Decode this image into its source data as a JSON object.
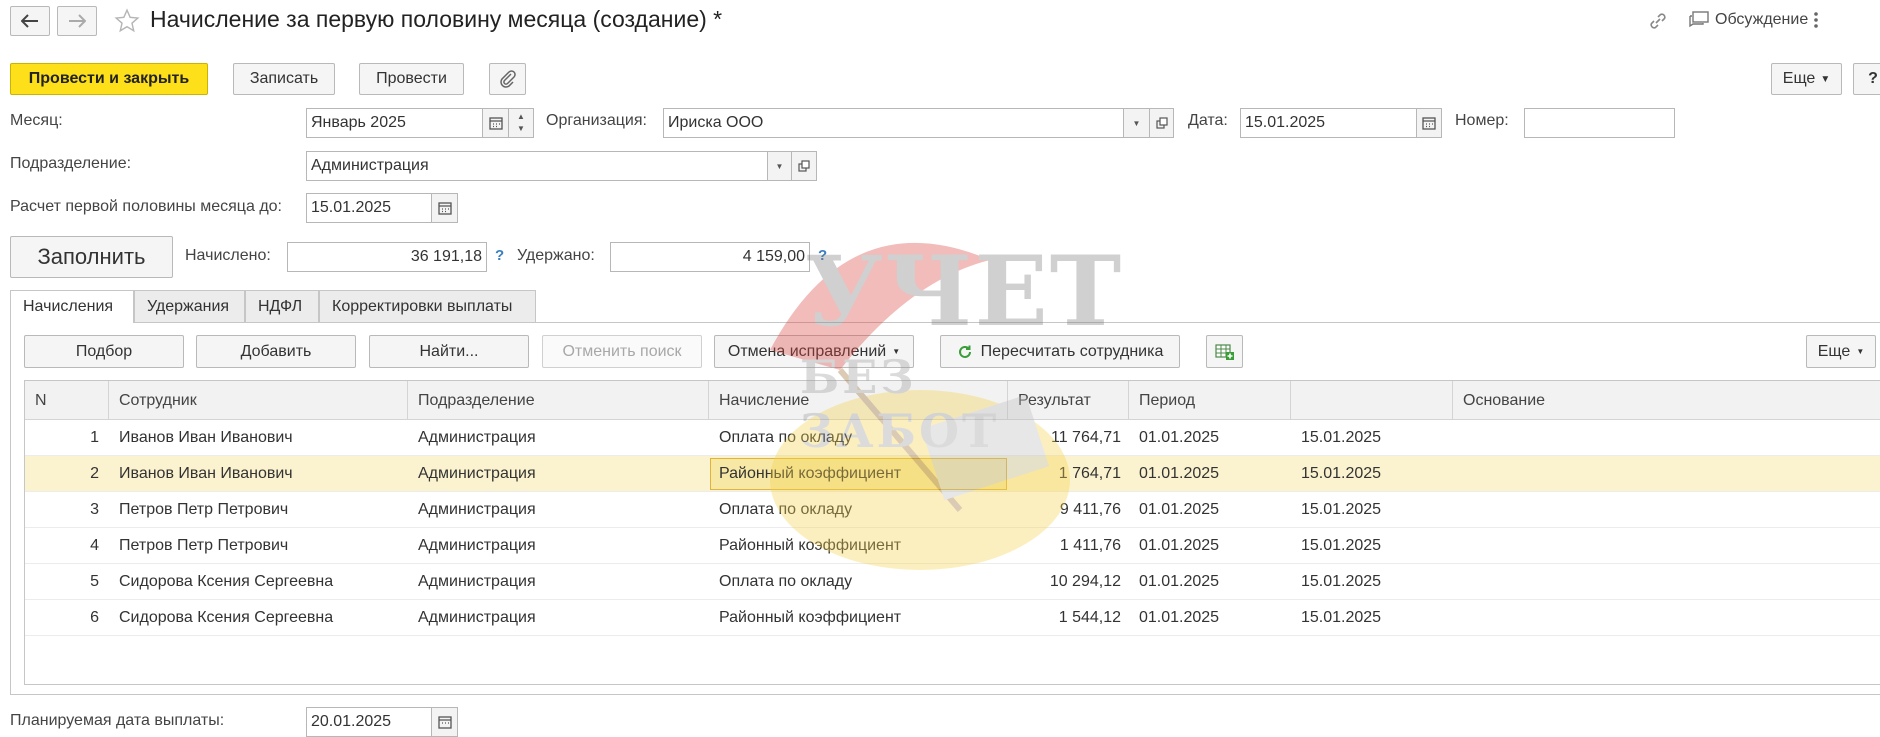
{
  "header": {
    "title": "Начисление за первую половину месяца (создание) *",
    "discussion_label": "Обсуждение"
  },
  "toolbar": {
    "post_close_label": "Провести и закрыть",
    "save_label": "Записать",
    "post_label": "Провести",
    "more_label": "Еще",
    "help_label": "?"
  },
  "form": {
    "month_label": "Месяц:",
    "month_value": "Январь 2025",
    "org_label": "Организация:",
    "org_value": "Ириска ООО",
    "date_label": "Дата:",
    "date_value": "15.01.2025",
    "number_label": "Номер:",
    "number_value": "",
    "dept_label": "Подразделение:",
    "dept_value": "Администрация",
    "calc_until_label": "Расчет первой половины месяца до:",
    "calc_until_value": "15.01.2025",
    "fill_label": "Заполнить",
    "accrued_label": "Начислено:",
    "accrued_value": "36 191,18",
    "withheld_label": "Удержано:",
    "withheld_value": "4 159,00",
    "help_mark": "?",
    "payment_date_label": "Планируемая дата выплаты:",
    "payment_date_value": "20.01.2025"
  },
  "tabs": [
    {
      "label": "Начисления"
    },
    {
      "label": "Удержания"
    },
    {
      "label": "НДФЛ"
    },
    {
      "label": "Корректировки выплаты"
    }
  ],
  "table_toolbar": {
    "pick_label": "Подбор",
    "add_label": "Добавить",
    "find_label": "Найти...",
    "cancel_search_label": "Отменить поиск",
    "cancel_corrections_label": "Отмена исправлений",
    "recalc_label": "Пересчитать сотрудника",
    "more_label": "Еще"
  },
  "table": {
    "columns": [
      "N",
      "Сотрудник",
      "Подразделение",
      "Начисление",
      "Результат",
      "Период",
      "",
      "Основание"
    ],
    "rows": [
      {
        "n": "1",
        "employee": "Иванов Иван Иванович",
        "dept": "Администрация",
        "accrual": "Оплата по окладу",
        "result": "11 764,71",
        "from": "01.01.2025",
        "to": "15.01.2025",
        "basis": ""
      },
      {
        "n": "2",
        "employee": "Иванов Иван Иванович",
        "dept": "Администрация",
        "accrual": "Районный коэффициент",
        "result": "1 764,71",
        "from": "01.01.2025",
        "to": "15.01.2025",
        "basis": ""
      },
      {
        "n": "3",
        "employee": "Петров Петр Петрович",
        "dept": "Администрация",
        "accrual": "Оплата по окладу",
        "result": "9 411,76",
        "from": "01.01.2025",
        "to": "15.01.2025",
        "basis": ""
      },
      {
        "n": "4",
        "employee": "Петров Петр Петрович",
        "dept": "Администрация",
        "accrual": "Районный коэффициент",
        "result": "1 411,76",
        "from": "01.01.2025",
        "to": "15.01.2025",
        "basis": ""
      },
      {
        "n": "5",
        "employee": "Сидорова Ксения Сергеевна",
        "dept": "Администрация",
        "accrual": "Оплата по окладу",
        "result": "10 294,12",
        "from": "01.01.2025",
        "to": "15.01.2025",
        "basis": ""
      },
      {
        "n": "6",
        "employee": "Сидорова Ксения Сергеевна",
        "dept": "Администрация",
        "accrual": "Районный коэффициент",
        "result": "1 544,12",
        "from": "01.01.2025",
        "to": "15.01.2025",
        "basis": ""
      }
    ]
  },
  "watermark": {
    "line1": "УЧЕТ",
    "line2": "БЕЗ ЗАБОТ"
  },
  "colors": {
    "primary_button": "#fde01a",
    "selected_row": "#fbf3cf",
    "focus_cell": "#f7e8a6",
    "help_blue": "#3a7fc2",
    "recalc_green": "#3a9d3a"
  }
}
